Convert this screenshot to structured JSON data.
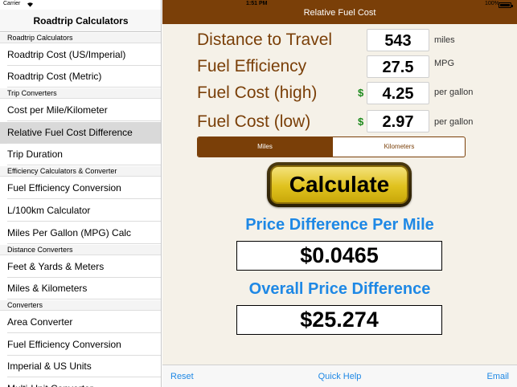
{
  "status_bar": {
    "carrier": "Carrier",
    "time": "1:51 PM",
    "battery": "100%"
  },
  "sidebar": {
    "title": "Roadtrip Calculators",
    "sections": [
      {
        "label": "Roadtrip Calculators",
        "items": [
          "Roadtrip Cost (US/Imperial)",
          "Roadtrip Cost (Metric)"
        ]
      },
      {
        "label": "Trip Converters",
        "items": [
          "Cost per Mile/Kilometer",
          "Relative Fuel Cost Difference",
          "Trip Duration"
        ]
      },
      {
        "label": "Efficiency Calculators & Converter",
        "items": [
          "Fuel Efficiency Conversion",
          "L/100km Calculator",
          "Miles Per Gallon (MPG) Calc"
        ]
      },
      {
        "label": "Distance Converters",
        "items": [
          "Feet & Yards & Meters",
          "Miles & Kilometers"
        ]
      },
      {
        "label": "Converters",
        "items": [
          "Area Converter",
          "Fuel Efficiency Conversion",
          "Imperial & US Units",
          "Multi-Unit Converter"
        ]
      }
    ],
    "selected": "Relative Fuel Cost Difference"
  },
  "main": {
    "nav_title": "Relative Fuel Cost",
    "fields": [
      {
        "label": "Distance to Travel",
        "value": "543",
        "unit": "miles",
        "currency": ""
      },
      {
        "label": "Fuel Efficiency",
        "value": "27.5",
        "unit": "MPG",
        "currency": ""
      },
      {
        "label": "Fuel Cost (high)",
        "value": "4.25",
        "unit": "per gallon",
        "currency": "$"
      },
      {
        "label": "Fuel Cost (low)",
        "value": "2.97",
        "unit": "per gallon",
        "currency": "$"
      }
    ],
    "segment": {
      "options": [
        "Miles",
        "Kilometers"
      ],
      "selected": "Miles"
    },
    "calculate_label": "Calculate",
    "results": [
      {
        "title": "Price Difference Per Mile",
        "value": "$0.0465"
      },
      {
        "title": "Overall Price Difference",
        "value": "$25.274"
      }
    ]
  },
  "toolbar": {
    "left": "Reset",
    "center": "Quick Help",
    "right": "Email"
  },
  "colors": {
    "nav_brown": "#7a3f08",
    "label_brown": "#7a3f08",
    "result_blue": "#1e88e5",
    "dollar_green": "#1d8a1d",
    "button_gold": "#e0c21e"
  }
}
